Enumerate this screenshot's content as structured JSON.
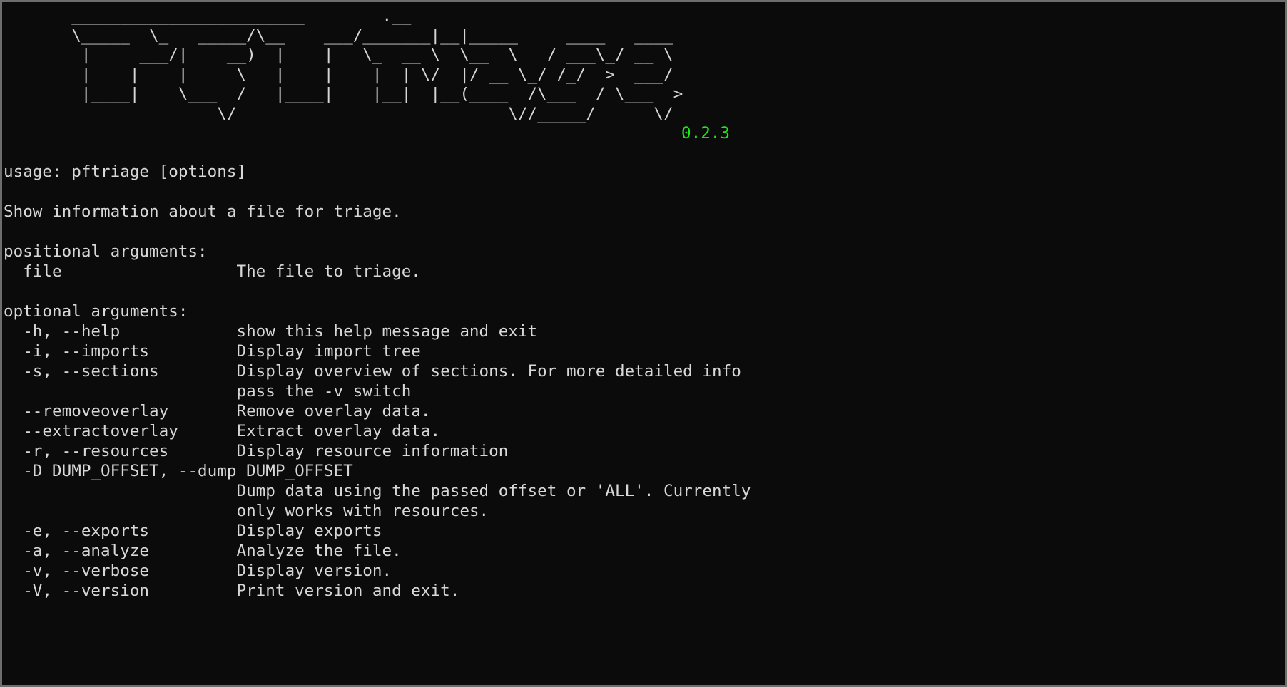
{
  "window": {
    "background_color": "#0b0b0b",
    "border_color": "#6e6e6e",
    "foreground_color": "#d8d8d8",
    "accent_color": "#1ee61e"
  },
  "banner": {
    "ascii_art": "       ________________________        .__\n       \\_____  \\_   _____/\\__    ___/_______|__|_____     ____   ____\n        |     ___/|    __)  |    |   \\_  __ \\  \\__  \\   / ___\\_/ __ \\\n        |    |    |     \\   |    |    |  | \\/  |/ __ \\_/ /_/  >  ___/\n        |____|    \\___  /   |____|    |__|  |__(____  /\\___  / \\___  >\n                      \\/                            \\//_____/      \\/",
    "version": "0.2.3"
  },
  "help": {
    "usage_line": "usage: pftriage [options]",
    "description": "Show information about a file for triage.",
    "positional_header": "positional arguments:",
    "positional_args": [
      {
        "flags": "file",
        "help": "The file to triage."
      }
    ],
    "optional_header": "optional arguments:",
    "optional_args": [
      {
        "flags": "-h, --help",
        "help": "show this help message and exit"
      },
      {
        "flags": "-i, --imports",
        "help": "Display import tree"
      },
      {
        "flags": "-s, --sections",
        "help": "Display overview of sections. For more detailed info\npass the -v switch"
      },
      {
        "flags": "--removeoverlay",
        "help": "Remove overlay data."
      },
      {
        "flags": "--extractoverlay",
        "help": "Extract overlay data."
      },
      {
        "flags": "-r, --resources",
        "help": "Display resource information"
      },
      {
        "flags": "-D DUMP_OFFSET, --dump DUMP_OFFSET",
        "help": "Dump data using the passed offset or 'ALL'. Currently\nonly works with resources."
      },
      {
        "flags": "-e, --exports",
        "help": "Display exports"
      },
      {
        "flags": "-a, --analyze",
        "help": "Analyze the file."
      },
      {
        "flags": "-v, --verbose",
        "help": "Display version."
      },
      {
        "flags": "-V, --version",
        "help": "Print version and exit."
      }
    ],
    "rendered_text": "usage: pftriage [options]\n\nShow information about a file for triage.\n\npositional arguments:\n  file                  The file to triage.\n\noptional arguments:\n  -h, --help            show this help message and exit\n  -i, --imports         Display import tree\n  -s, --sections        Display overview of sections. For more detailed info\n                        pass the -v switch\n  --removeoverlay       Remove overlay data.\n  --extractoverlay      Extract overlay data.\n  -r, --resources       Display resource information\n  -D DUMP_OFFSET, --dump DUMP_OFFSET\n                        Dump data using the passed offset or 'ALL'. Currently\n                        only works with resources.\n  -e, --exports         Display exports\n  -a, --analyze         Analyze the file.\n  -v, --verbose         Display version.\n  -V, --version         Print version and exit."
  }
}
